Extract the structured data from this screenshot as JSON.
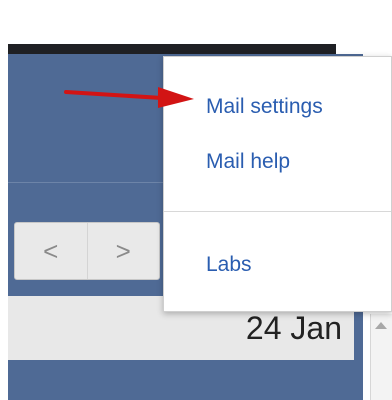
{
  "menu": {
    "items": [
      {
        "label": "Mail settings"
      },
      {
        "label": "Mail help"
      },
      {
        "label": "Labs"
      }
    ]
  },
  "toolbar": {
    "prev_icon": "chevron-left-icon",
    "next_icon": "chevron-right-icon",
    "prev_glyph": "<",
    "next_glyph": ">"
  },
  "list": {
    "date": "24 Jan"
  },
  "annotation": {
    "arrow_color": "#d21414",
    "icon": "red-arrow-annotation"
  },
  "colors": {
    "panel": "#4f6a95",
    "link": "#2a5db0",
    "menu_bg": "#ffffff"
  }
}
